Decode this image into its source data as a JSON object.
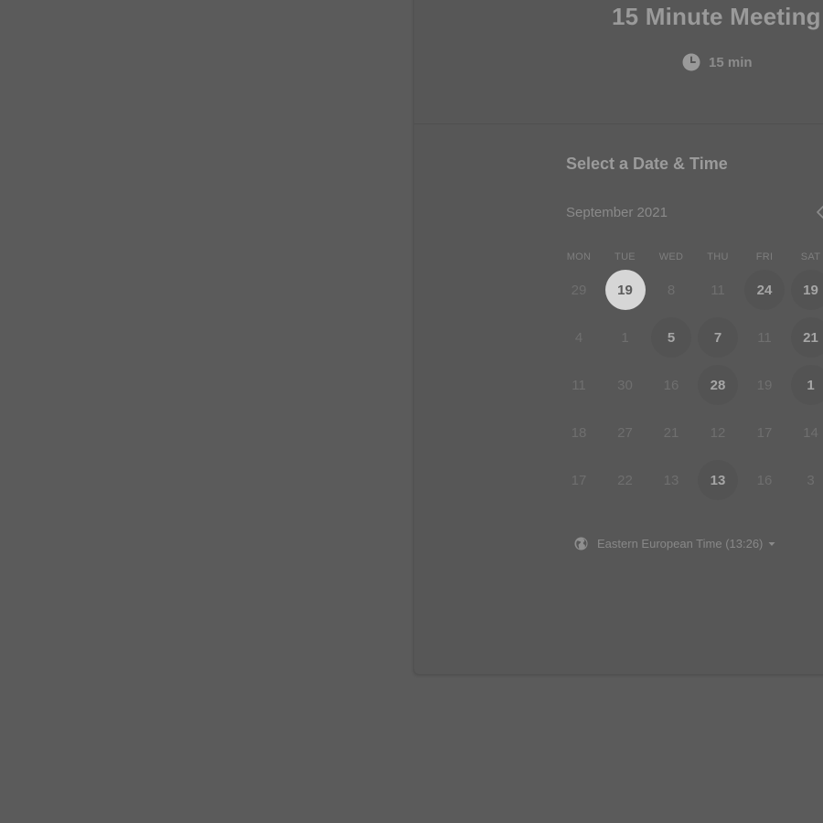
{
  "event": {
    "title": "15 Minute Meeting",
    "duration": "15 min",
    "duration_icon": "clock-icon"
  },
  "calendar": {
    "section_title": "Select a Date & Time",
    "month_label": "September 2021",
    "prev_icon": "chevron-left-icon",
    "weekdays": [
      "MON",
      "TUE",
      "WED",
      "THU",
      "FRI",
      "SAT"
    ],
    "weeks": [
      [
        {
          "label": "29",
          "state": "disabled"
        },
        {
          "label": "19",
          "state": "selected"
        },
        {
          "label": "8",
          "state": "disabled"
        },
        {
          "label": "11",
          "state": "disabled"
        },
        {
          "label": "24",
          "state": "available"
        },
        {
          "label": "19",
          "state": "available"
        }
      ],
      [
        {
          "label": "4",
          "state": "disabled"
        },
        {
          "label": "1",
          "state": "disabled"
        },
        {
          "label": "5",
          "state": "available"
        },
        {
          "label": "7",
          "state": "available"
        },
        {
          "label": "11",
          "state": "disabled"
        },
        {
          "label": "21",
          "state": "available"
        }
      ],
      [
        {
          "label": "11",
          "state": "disabled"
        },
        {
          "label": "30",
          "state": "disabled"
        },
        {
          "label": "16",
          "state": "disabled"
        },
        {
          "label": "28",
          "state": "available"
        },
        {
          "label": "19",
          "state": "disabled"
        },
        {
          "label": "1",
          "state": "available"
        }
      ],
      [
        {
          "label": "18",
          "state": "disabled"
        },
        {
          "label": "27",
          "state": "disabled"
        },
        {
          "label": "21",
          "state": "disabled"
        },
        {
          "label": "12",
          "state": "disabled"
        },
        {
          "label": "17",
          "state": "disabled"
        },
        {
          "label": "14",
          "state": "disabled"
        }
      ],
      [
        {
          "label": "17",
          "state": "disabled"
        },
        {
          "label": "22",
          "state": "disabled"
        },
        {
          "label": "13",
          "state": "disabled"
        },
        {
          "label": "13",
          "state": "available"
        },
        {
          "label": "16",
          "state": "disabled"
        },
        {
          "label": "3",
          "state": "disabled"
        }
      ]
    ]
  },
  "timezone": {
    "label": "Eastern European Time (13:26)",
    "icon": "globe-icon",
    "dropdown_icon": "caret-down-icon"
  }
}
